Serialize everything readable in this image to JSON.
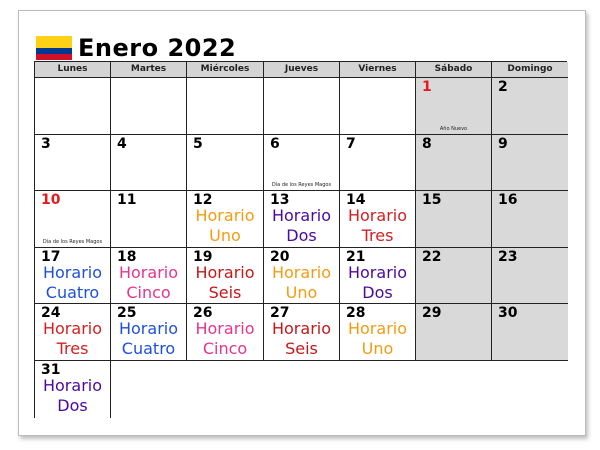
{
  "title": "Enero 2022",
  "flag_colors": {
    "yellow": "#fcd116",
    "blue": "#003893",
    "red": "#ce1126"
  },
  "weekdays": [
    "Lunes",
    "Martes",
    "Miércoles",
    "Jueves",
    "Viernes",
    "Sábado",
    "Domingo"
  ],
  "shift_colors": {
    "Uno": "#f39c12",
    "Dos": "#4b0a9c",
    "Tres": "#d21f1f",
    "Cuatro": "#1e50dc",
    "Cinco": "#e6358c",
    "Seis": "#c41818"
  },
  "horario_word": "Horario",
  "days": [
    {
      "n": "",
      "w": false
    },
    {
      "n": "",
      "w": false
    },
    {
      "n": "",
      "w": false
    },
    {
      "n": "",
      "w": false
    },
    {
      "n": "",
      "w": false
    },
    {
      "n": "1",
      "w": true,
      "holiday": true,
      "note": "Año Nuevo"
    },
    {
      "n": "2",
      "w": true
    },
    {
      "n": "3"
    },
    {
      "n": "4"
    },
    {
      "n": "5"
    },
    {
      "n": "6",
      "note": "Día de los Reyes Magos"
    },
    {
      "n": "7"
    },
    {
      "n": "8",
      "w": true
    },
    {
      "n": "9",
      "w": true
    },
    {
      "n": "10",
      "holiday": true,
      "note": "Día de los Reyes Magos"
    },
    {
      "n": "11"
    },
    {
      "n": "12",
      "shift": "Uno"
    },
    {
      "n": "13",
      "shift": "Dos"
    },
    {
      "n": "14",
      "shift": "Tres"
    },
    {
      "n": "15",
      "w": true
    },
    {
      "n": "16",
      "w": true
    },
    {
      "n": "17",
      "shift": "Cuatro"
    },
    {
      "n": "18",
      "shift": "Cinco"
    },
    {
      "n": "19",
      "shift": "Seis"
    },
    {
      "n": "20",
      "shift": "Uno"
    },
    {
      "n": "21",
      "shift": "Dos"
    },
    {
      "n": "22",
      "w": true
    },
    {
      "n": "23",
      "w": true
    },
    {
      "n": "24",
      "shift": "Tres"
    },
    {
      "n": "25",
      "shift": "Cuatro"
    },
    {
      "n": "26",
      "shift": "Cinco"
    },
    {
      "n": "27",
      "shift": "Seis"
    },
    {
      "n": "28",
      "shift": "Uno"
    },
    {
      "n": "29",
      "w": true
    },
    {
      "n": "30",
      "w": true
    },
    {
      "n": "31",
      "shift": "Dos"
    }
  ]
}
